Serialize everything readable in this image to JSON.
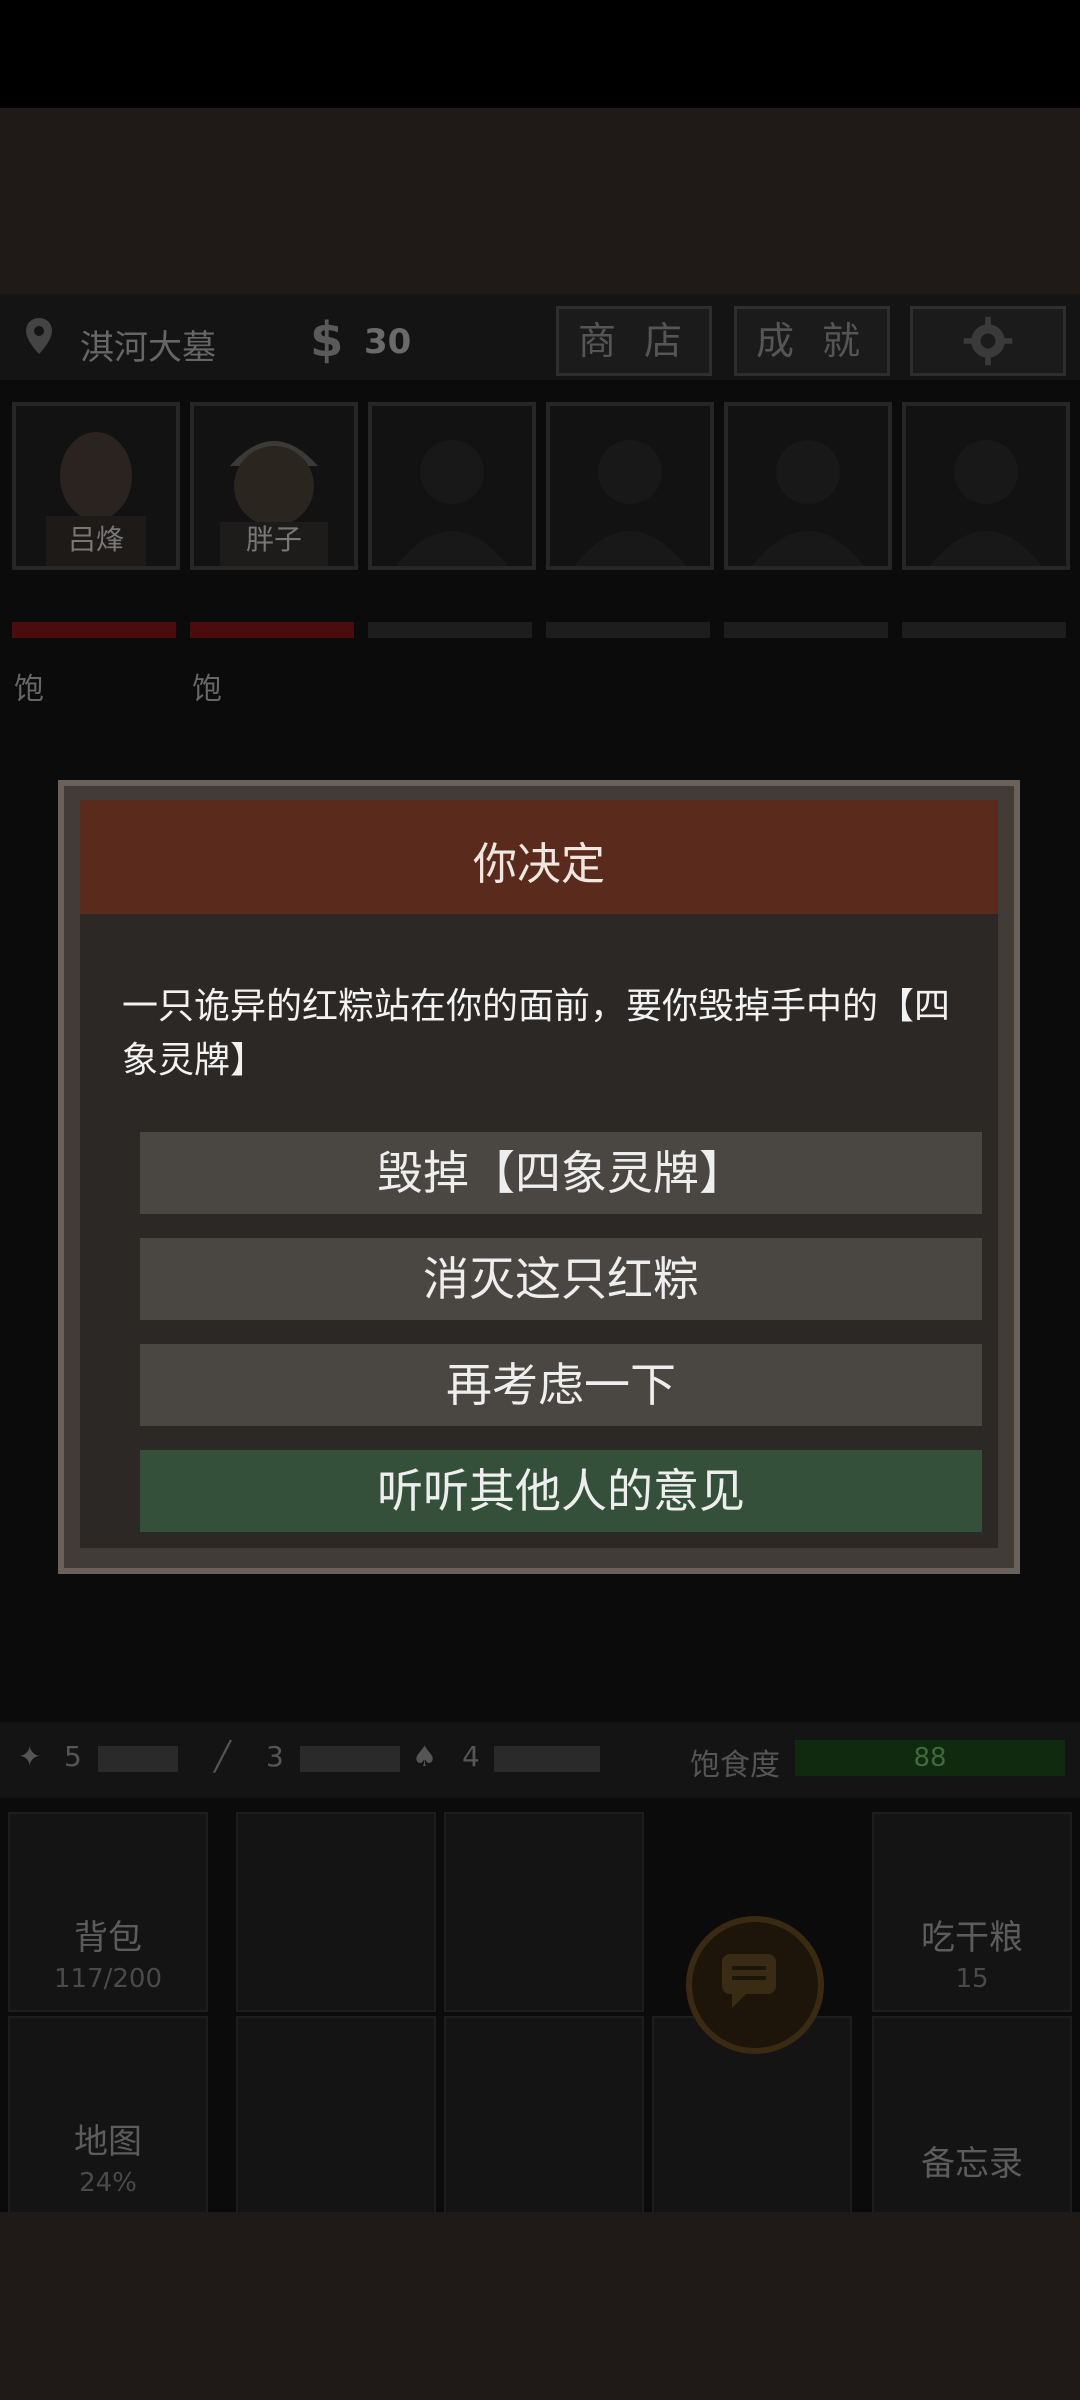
{
  "topbar": {
    "location": "淇河大墓",
    "money_symbol": "$",
    "money": "30",
    "shop_label": "商 店",
    "achievements_label": "成 就",
    "settings_icon": "gear-icon"
  },
  "party": [
    {
      "name": "吕烽",
      "status": "饱"
    },
    {
      "name": "胖子",
      "status": "饱"
    }
  ],
  "dialog": {
    "title": "你决定",
    "message": "一只诡异的红粽站在你的面前，要你毁掉手中的【四象灵牌】",
    "choices": [
      {
        "label": "毁掉【四象灵牌】"
      },
      {
        "label": "消灭这只红粽"
      },
      {
        "label": "再考虑一下"
      },
      {
        "label": "听听其他人的意见"
      }
    ]
  },
  "hud": {
    "tools": [
      {
        "icon": "torch-icon",
        "count": "5"
      },
      {
        "icon": "rope-icon",
        "count": "3"
      },
      {
        "icon": "shovel-icon",
        "count": "4"
      }
    ],
    "satiety_label": "饱食度",
    "satiety_value": "88"
  },
  "tiles": {
    "backpack": {
      "label": "背包",
      "sub": "117/200"
    },
    "eat": {
      "label": "吃干粮",
      "sub": "15"
    },
    "map": {
      "label": "地图",
      "sub": "24%"
    },
    "memo": {
      "label": "备忘录"
    }
  },
  "colors": {
    "accent_red": "#5a2a1c",
    "accent_green": "#34503a"
  }
}
